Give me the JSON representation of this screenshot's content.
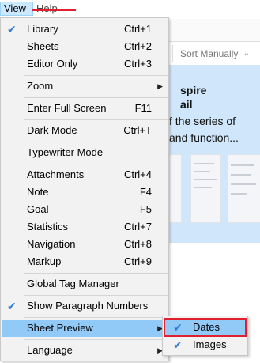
{
  "menubar": {
    "view_label": "View",
    "help_label": "Help",
    "annotation_color": "#e0202e"
  },
  "background_app": {
    "sort_label": "Sort Manually",
    "preview_title_lines": [
      "spire",
      "ail"
    ],
    "preview_text_lines": [
      "f the series of",
      "and function..."
    ]
  },
  "view_menu": {
    "items": [
      {
        "label": "Library",
        "shortcut": "Ctrl+1",
        "checked": true
      },
      {
        "label": "Sheets",
        "shortcut": "Ctrl+2",
        "checked": false
      },
      {
        "label": "Editor Only",
        "shortcut": "Ctrl+3",
        "checked": false
      },
      {
        "label": "Zoom",
        "shortcut": "",
        "submenu": true
      },
      {
        "label": "Enter Full Screen",
        "shortcut": "F11"
      },
      {
        "label": "Dark Mode",
        "shortcut": "Ctrl+T"
      },
      {
        "label": "Typewriter Mode",
        "shortcut": ""
      },
      {
        "label": "Attachments",
        "shortcut": "Ctrl+4"
      },
      {
        "label": "Note",
        "shortcut": "F4"
      },
      {
        "label": "Goal",
        "shortcut": "F5"
      },
      {
        "label": "Statistics",
        "shortcut": "Ctrl+7"
      },
      {
        "label": "Navigation",
        "shortcut": "Ctrl+8"
      },
      {
        "label": "Markup",
        "shortcut": "Ctrl+9"
      },
      {
        "label": "Global Tag Manager",
        "shortcut": ""
      },
      {
        "label": "Show Paragraph Numbers",
        "shortcut": "",
        "checked": true
      },
      {
        "label": "Sheet Preview",
        "shortcut": "",
        "submenu": true,
        "highlighted": true
      },
      {
        "label": "Language",
        "shortcut": "",
        "submenu": true
      }
    ]
  },
  "sheet_preview_submenu": {
    "items": [
      {
        "label": "Dates",
        "checked": true,
        "highlighted": true
      },
      {
        "label": "Images",
        "checked": true
      }
    ]
  },
  "icons": {
    "check": "checkmark-icon",
    "submenu": "chevron-right-icon",
    "dropdown": "chevron-down-icon"
  },
  "colors": {
    "highlight": "#91c9f7",
    "check": "#2f7dd3",
    "annotation": "#e0202e"
  }
}
